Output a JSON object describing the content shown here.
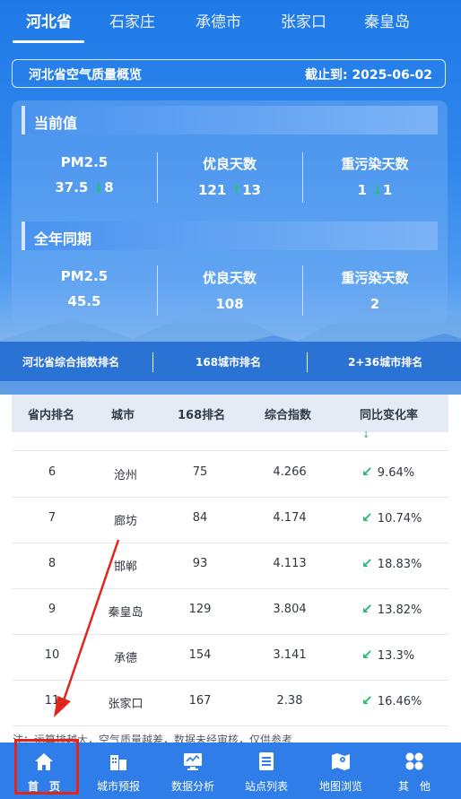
{
  "tabs": [
    "河北省",
    "石家庄",
    "承德市",
    "张家口",
    "秦皇岛"
  ],
  "overview": {
    "title": "河北省空气质量概览",
    "date_label": "截止到: 2025-06-02"
  },
  "current": {
    "heading": "当前值",
    "stats": [
      {
        "label": "PM2.5",
        "value": "37.5",
        "change": "8",
        "dir": "down"
      },
      {
        "label": "优良天数",
        "value": "121",
        "change": "13",
        "dir": "up"
      },
      {
        "label": "重污染天数",
        "value": "1",
        "change": "1",
        "dir": "down"
      }
    ]
  },
  "last_year": {
    "heading": "全年同期",
    "stats": [
      {
        "label": "PM2.5",
        "value": "45.5"
      },
      {
        "label": "优良天数",
        "value": "108"
      },
      {
        "label": "重污染天数",
        "value": "2"
      }
    ]
  },
  "rank_tabs": [
    "河北省综合指数排名",
    "168城市排名",
    "2+36城市排名"
  ],
  "table": {
    "headers": [
      "省内排名",
      "城市",
      "168排名",
      "综合指数",
      "同比变化率"
    ],
    "rows": [
      {
        "rank": "6",
        "city": "沧州",
        "r168": "75",
        "index": "4.266",
        "change": "9.64%"
      },
      {
        "rank": "7",
        "city": "廊坊",
        "r168": "84",
        "index": "4.174",
        "change": "10.74%"
      },
      {
        "rank": "8",
        "city": "邯郸",
        "r168": "93",
        "index": "4.113",
        "change": "18.83%"
      },
      {
        "rank": "9",
        "city": "秦皇岛",
        "r168": "129",
        "index": "3.804",
        "change": "13.82%"
      },
      {
        "rank": "10",
        "city": "承德",
        "r168": "154",
        "index": "3.141",
        "change": "13.3%"
      },
      {
        "rank": "11",
        "city": "张家口",
        "r168": "167",
        "index": "2.38",
        "change": "16.46%"
      }
    ]
  },
  "note": "注：运算排越大，空气质量越差，数据未经审核，仅供参考",
  "bottom_nav": [
    {
      "label": "首　页",
      "icon": "home-icon"
    },
    {
      "label": "城市预报",
      "icon": "city-forecast-icon"
    },
    {
      "label": "数据分析",
      "icon": "data-analysis-icon"
    },
    {
      "label": "站点列表",
      "icon": "station-list-icon"
    },
    {
      "label": "地图浏览",
      "icon": "map-icon"
    },
    {
      "label": "其　他",
      "icon": "more-icon"
    }
  ],
  "colors": {
    "primary": "#2f7de8",
    "header": "#1f7ae8",
    "arrow": "#23b86c",
    "annotation": "#e0251b"
  }
}
